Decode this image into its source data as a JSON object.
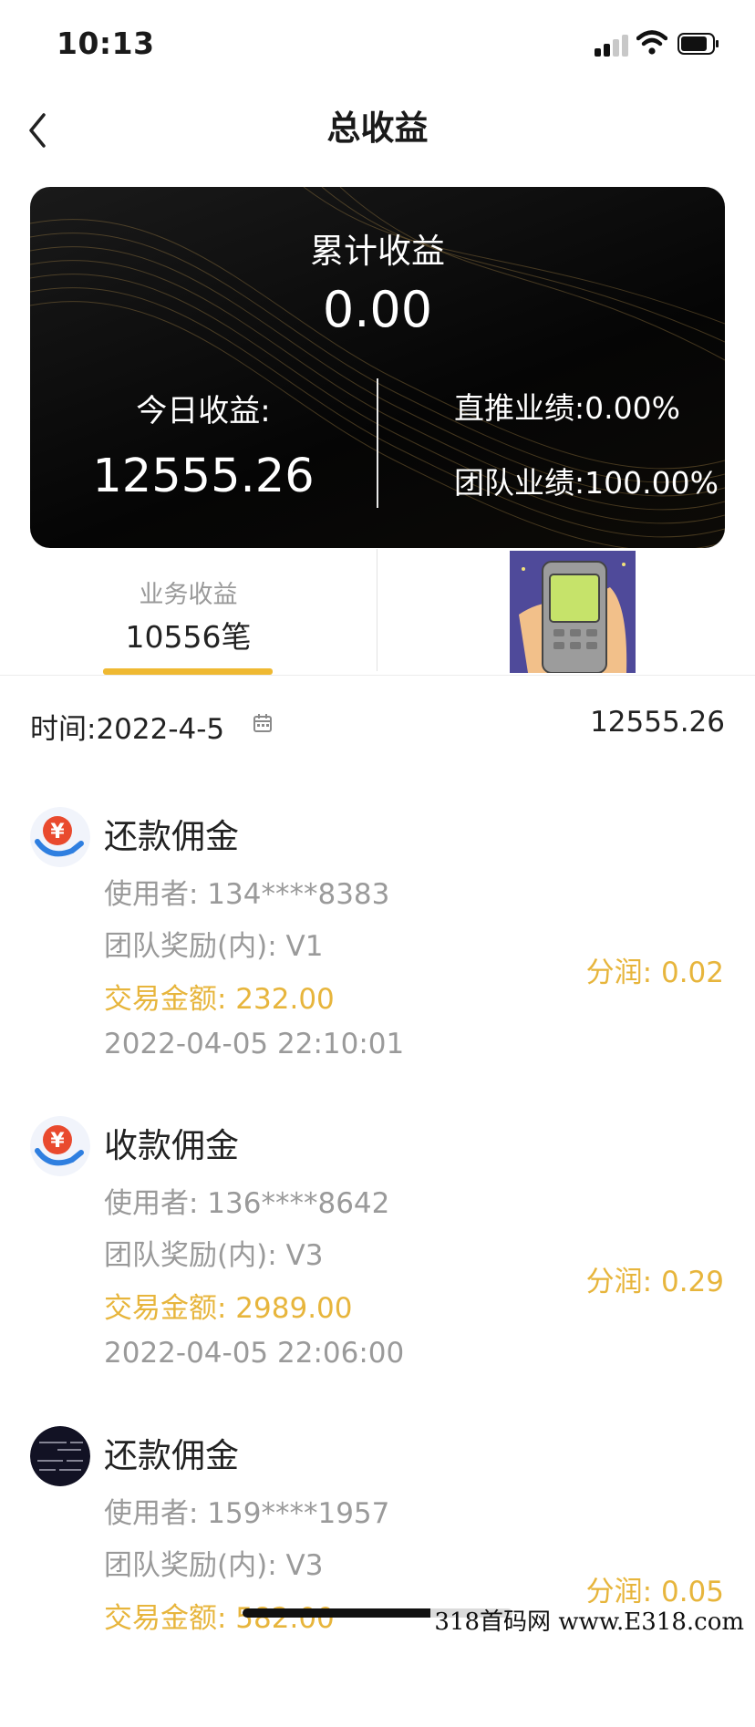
{
  "status": {
    "time": "10:13"
  },
  "nav": {
    "title": "总收益",
    "back_icon": "chevron-left-icon"
  },
  "card": {
    "cumulative_label": "累计收益",
    "cumulative_value": "0.00",
    "today_label": "今日收益:",
    "today_value": "12555.26",
    "direct_perf": "直推业绩:0.00%",
    "team_perf": "团队业绩:100.00%"
  },
  "tabs": {
    "business_label": "业务收益",
    "business_count": "10556笔"
  },
  "date_row": {
    "date_text": "时间:2022-4-5",
    "total": "12555.26"
  },
  "records": [
    {
      "title": "还款佣金",
      "user": "使用者: 134****8383",
      "reward": "团队奖励(内): V1",
      "amount": "交易金额: 232.00",
      "time": "2022-04-05 22:10:01",
      "share": "分润: 0.02",
      "icon": "yen-hand-icon"
    },
    {
      "title": "收款佣金",
      "user": "使用者: 136****8642",
      "reward": "团队奖励(内): V3",
      "amount": "交易金额: 2989.00",
      "time": "2022-04-05 22:06:00",
      "share": "分润: 0.29",
      "icon": "yen-hand-icon"
    },
    {
      "title": "还款佣金",
      "user": "使用者: 159****1957",
      "reward": "团队奖励(内): V3",
      "amount": "交易金额: 582.00",
      "share": "分润: 0.05",
      "icon": "avatar"
    }
  ],
  "watermark": "318首码网  www.E318.com",
  "colors": {
    "accent": "#efb932",
    "gold_text": "#e7b53c",
    "card_bg": "#0a0a0a"
  }
}
